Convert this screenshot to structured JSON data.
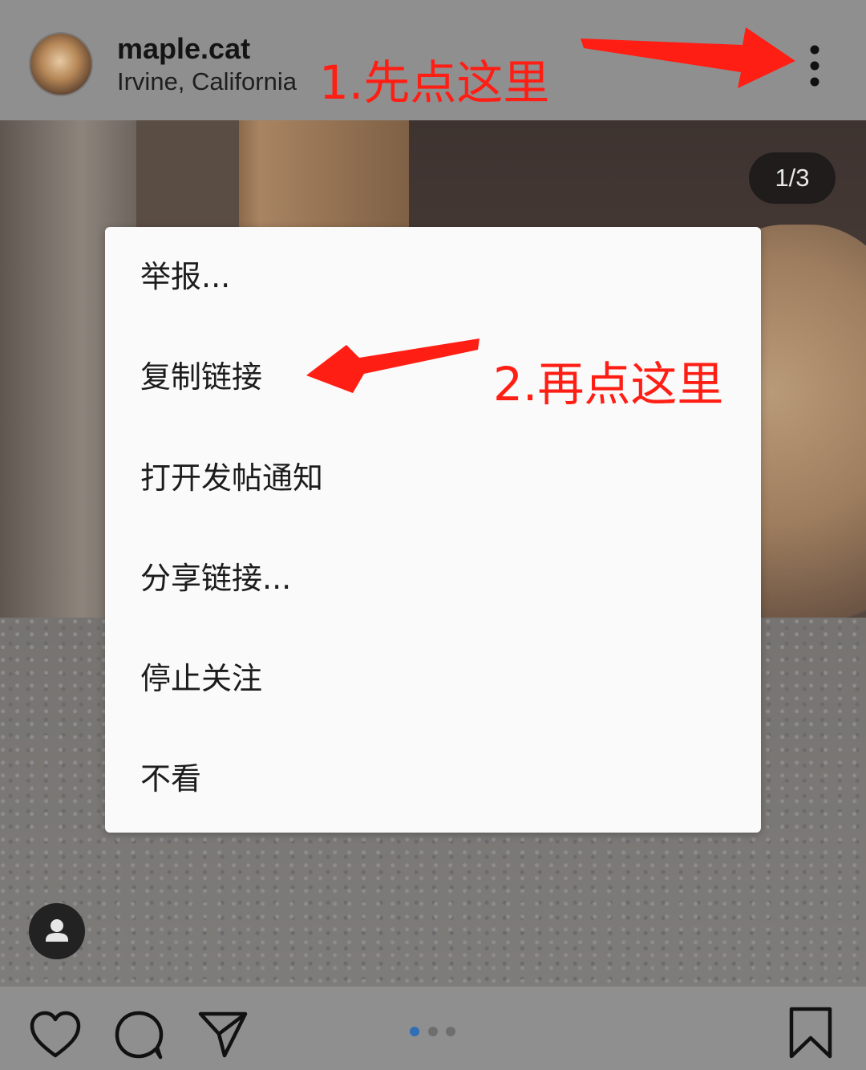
{
  "post": {
    "username": "maple.cat",
    "location": "Irvine, California",
    "image_counter": "1/3",
    "carousel": {
      "count": 3,
      "active_index": 0
    }
  },
  "annotations": {
    "step1": "1.先点这里",
    "step2": "2.再点这里",
    "color": "#ff1e14"
  },
  "menu": {
    "items": [
      {
        "label": "举报..."
      },
      {
        "label": "复制链接"
      },
      {
        "label": "打开发帖通知"
      },
      {
        "label": "分享链接..."
      },
      {
        "label": "停止关注"
      },
      {
        "label": "不看"
      }
    ]
  },
  "icons": {
    "header": [
      "avatar",
      "more-vertical-icon"
    ],
    "photo": [
      "tag-people-icon"
    ],
    "actions": [
      "heart-icon",
      "comment-icon",
      "send-icon",
      "bookmark-icon"
    ]
  },
  "colors": {
    "dim_overlay": "#8f8f8f",
    "menu_background": "#fafafa",
    "active_dot": "#2f6fb5"
  }
}
